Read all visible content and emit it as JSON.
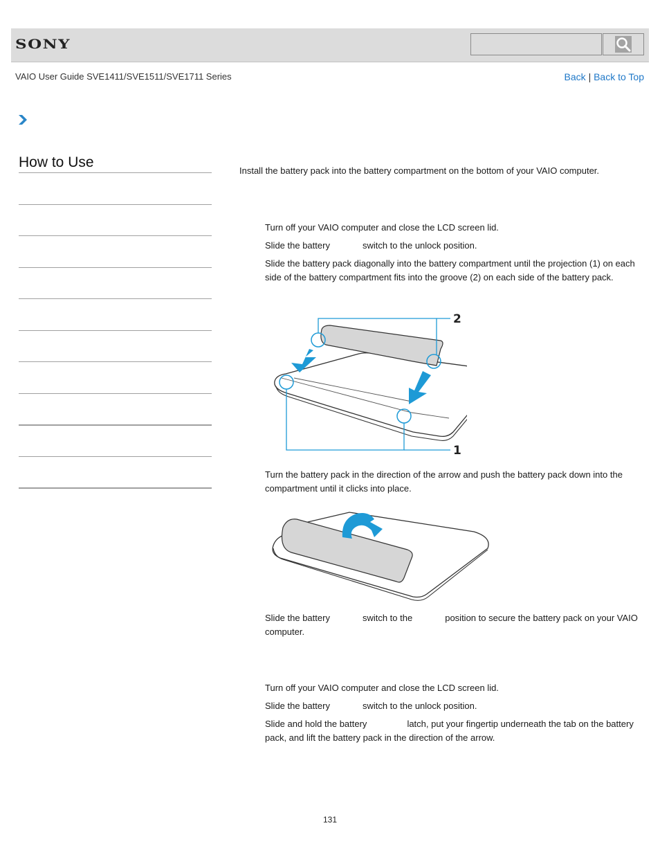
{
  "header": {
    "logo": "SONY",
    "search": {
      "value": "",
      "placeholder": "",
      "button_icon": "search-icon"
    }
  },
  "subheader": {
    "guide_title": "VAIO User Guide SVE1411/SVE1511/SVE1711 Series",
    "back_label": "Back",
    "separator": "|",
    "back_to_top_label": "Back to Top"
  },
  "breadcrumb": {
    "icon": "chevron-right-icon"
  },
  "sidebar": {
    "title": "How to Use",
    "items": [
      "",
      "",
      "",
      "",
      "",
      "",
      "",
      "",
      "",
      ""
    ]
  },
  "main": {
    "intro": "Install the battery pack into the battery compartment on the bottom of your VAIO computer.",
    "install_steps": [
      {
        "text": "Turn off your VAIO computer and close the LCD screen lid."
      },
      {
        "before": "Slide the battery",
        "after": "switch to the unlock position."
      },
      {
        "text": "Slide the battery pack diagonally into the battery compartment until the projection (1) on each side of the battery compartment fits into the groove (2) on each side of the battery pack."
      },
      {
        "text": "Turn the battery pack in the direction of the arrow and push the battery pack down into the compartment until it clicks into place."
      },
      {
        "before": "Slide the battery",
        "middle": "switch to the",
        "after": "position to secure the battery pack on your VAIO computer."
      }
    ],
    "figure1": {
      "label_groove": "2",
      "label_projection": "1",
      "accent_color": "#1e9ad6"
    },
    "remove_steps": [
      {
        "text": "Turn off your VAIO computer and close the LCD screen lid."
      },
      {
        "before": "Slide the battery",
        "after": "switch to the unlock position."
      },
      {
        "before": "Slide and hold the battery",
        "after": "latch, put your fingertip underneath the tab on the battery pack, and lift the battery pack in the direction of the arrow."
      }
    ]
  },
  "footer": {
    "page_number": "131"
  }
}
